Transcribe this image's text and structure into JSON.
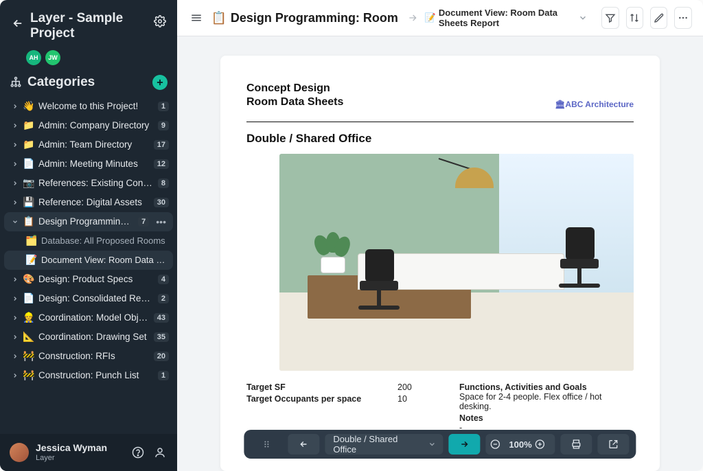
{
  "app_title": "Layer - Sample Project",
  "avatars": [
    {
      "initials": "AH",
      "color": "#16b67d"
    },
    {
      "initials": "JW",
      "color": "#22c56f"
    }
  ],
  "categories_header": "Categories",
  "tree": [
    {
      "icon": "👋",
      "label": "Welcome to this Project!",
      "badge": "1"
    },
    {
      "icon": "📁",
      "label": "Admin: Company Directory",
      "badge": "9"
    },
    {
      "icon": "📁",
      "label": "Admin: Team Directory",
      "badge": "17"
    },
    {
      "icon": "📄",
      "label": "Admin: Meeting Minutes",
      "badge": "12"
    },
    {
      "icon": "📷",
      "label": "References: Existing Conditions",
      "badge": "8"
    },
    {
      "icon": "💾",
      "label": "Reference: Digital Assets",
      "badge": "30"
    },
    {
      "icon": "📋",
      "label": "Design Programming: Room",
      "badge": "7",
      "expanded": true,
      "children": [
        {
          "icon": "🗂️",
          "label": "Database: All Proposed Rooms"
        },
        {
          "icon": "📝",
          "label": "Document View: Room Data Sheets",
          "selected": true
        }
      ]
    },
    {
      "icon": "🎨",
      "label": "Design: Product Specs",
      "badge": "4"
    },
    {
      "icon": "📄",
      "label": "Design: Consolidated Report",
      "badge": "2"
    },
    {
      "icon": "👷",
      "label": "Coordination: Model Objects",
      "badge": "43"
    },
    {
      "icon": "📐",
      "label": "Coordination: Drawing Set",
      "badge": "35"
    },
    {
      "icon": "🚧",
      "label": "Construction: RFIs",
      "badge": "20"
    },
    {
      "icon": "🚧",
      "label": "Construction: Punch List",
      "badge": "1"
    }
  ],
  "user": {
    "name": "Jessica Wyman",
    "role": "Layer"
  },
  "toolbar": {
    "crumb_icon": "📋",
    "crumb_main": "Design Programming: Room Data S…",
    "crumb_sub_icon": "📝",
    "crumb_sub": "Document View: Room Data Sheets Report"
  },
  "document": {
    "header_line1": "Concept Design",
    "header_line2": "Room Data Sheets",
    "brand": "🏛ABC Architecture",
    "room_title": "Double / Shared Office",
    "fields_left": [
      {
        "label": "Target SF",
        "value": "200"
      },
      {
        "label": "Target Occupants per space",
        "value": "10"
      }
    ],
    "fields_right": [
      {
        "label": "Functions, Activities and Goals",
        "value": "Space for 2-4 people. Flex office / hot desking."
      },
      {
        "label": "Notes",
        "value": "-"
      }
    ]
  },
  "footer": {
    "selector": "Double / Shared Office",
    "zoom": "100%"
  }
}
